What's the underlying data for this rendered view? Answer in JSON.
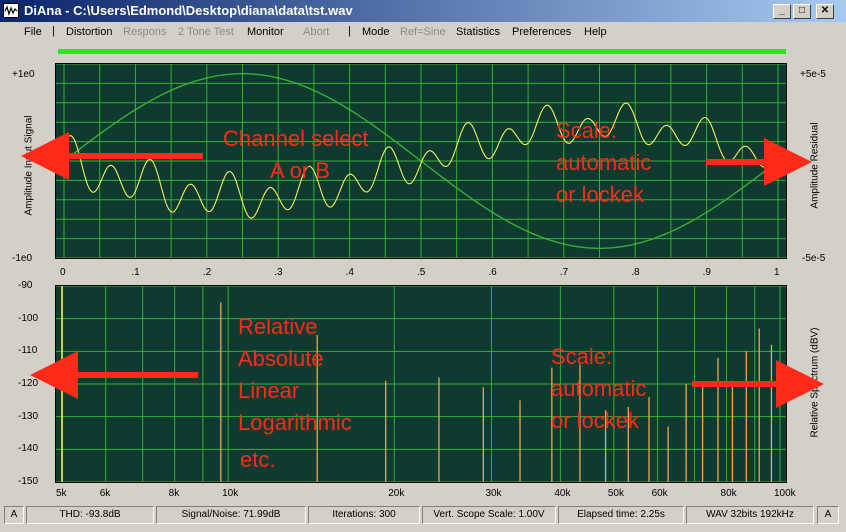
{
  "window": {
    "title": "DiAna - C:\\Users\\Edmond\\Desktop\\diana\\data\\tst.wav",
    "minimize": "_",
    "maximize": "□",
    "close": "✕"
  },
  "menu": [
    {
      "label": "File",
      "enabled": true
    },
    {
      "label": "Distortion",
      "enabled": true
    },
    {
      "label": "Respons",
      "enabled": false
    },
    {
      "label": "2 Tone Test",
      "enabled": false
    },
    {
      "label": "Monitor",
      "enabled": true
    },
    {
      "label": "Abort",
      "enabled": false
    },
    {
      "label": "Mode",
      "enabled": true
    },
    {
      "label": "Ref=Sine",
      "enabled": false
    },
    {
      "label": "Statistics",
      "enabled": true
    },
    {
      "label": "Preferences",
      "enabled": true
    },
    {
      "label": "Help",
      "enabled": true
    }
  ],
  "menu_separator": "|",
  "progress": 1.0,
  "colors": {
    "plot_bg": "#0e3a2f",
    "grid": "#35b035",
    "trace": "#f2f25a",
    "lines": "#e8a850",
    "progress": "#22e822",
    "annotation": "#ff2a1a"
  },
  "scope": {
    "left_axis_label": "Amplitude Input Signal",
    "right_axis_label": "Amplitude Residual",
    "left_top": "+1e0",
    "left_bottom": "-1e0",
    "right_top": "+5e-5",
    "right_bottom": "-5e-5",
    "x_ticks": [
      "0",
      ".1",
      ".2",
      ".3",
      ".4",
      ".5",
      ".6",
      ".7",
      ".8",
      ".9",
      "1"
    ]
  },
  "spectrum": {
    "right_axis_label": "Relative Spectrum (dBV)",
    "y_ticks": [
      "-90",
      "-100",
      "-110",
      "-120",
      "-130",
      "-140",
      "-150"
    ],
    "x_ticks": [
      "5k",
      "6k",
      "8k",
      "10k",
      "20k",
      "30k",
      "40k",
      "50k",
      "60k",
      "80k",
      "100k"
    ]
  },
  "annotations": {
    "channel": [
      "Channel select",
      "A or B"
    ],
    "scale_top": [
      "Scale:",
      "automatic",
      "or lockek"
    ],
    "modes": [
      "Relative",
      "Absolute",
      "Linear",
      "Logarithmic",
      "etc."
    ],
    "scale_bottom": [
      "Scale:",
      "automatic",
      "or lockek"
    ]
  },
  "status": {
    "left_channel": "A",
    "thd": "THD:  -93.8dB",
    "snr": "Signal/Noise:  71.99dB",
    "iterations": "Iterations: 300",
    "vscale": "Vert. Scope Scale: 1.00V",
    "elapsed": "Elapsed time: 2.25s",
    "format": "WAV 32bits 192kHz",
    "right_channel": "A"
  },
  "chart_data": [
    {
      "type": "line",
      "x": [
        0,
        0.1,
        0.2,
        0.3,
        0.4,
        0.5,
        0.6,
        0.7,
        0.8,
        0.9,
        1.0
      ],
      "series": [
        {
          "values": [
            0,
            0.59,
            0.95,
            0.95,
            0.59,
            0,
            -0.59,
            -0.95,
            -0.95,
            -0.59,
            0
          ]
        }
      ],
      "ylim": [
        -1,
        1
      ]
    },
    {
      "type": "bar",
      "x_scale": "log",
      "xlim": [
        5000,
        100000
      ],
      "ylim": [
        -150,
        -90
      ],
      "x": [
        9700,
        14500,
        19300,
        24100,
        29000,
        33800,
        38600,
        43400,
        48300,
        53100,
        57900,
        62700,
        67600,
        72400,
        77200,
        82000,
        86900,
        91700,
        96500
      ],
      "values": [
        -95,
        -105,
        -119,
        -118,
        -121,
        -125,
        -115,
        -114,
        -128,
        -127,
        -124,
        -133,
        -120,
        -120,
        -112,
        -119,
        -110,
        -103,
        -108
      ]
    }
  ]
}
